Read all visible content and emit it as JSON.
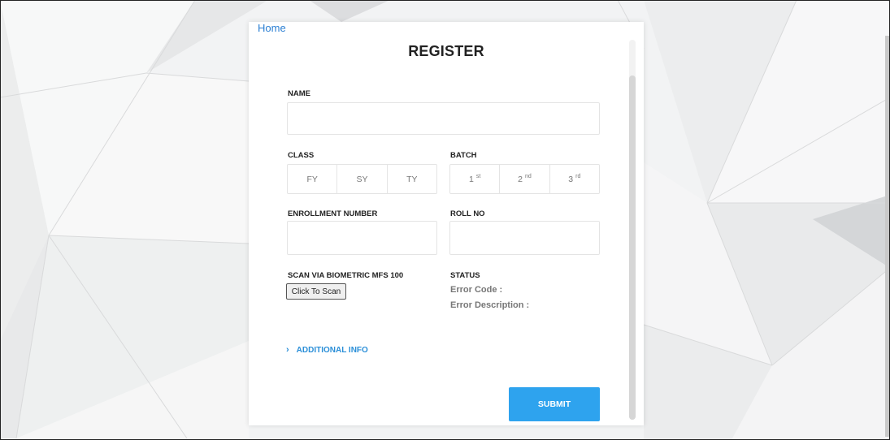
{
  "nav": {
    "home_label": "Home"
  },
  "form": {
    "title": "REGISTER",
    "name": {
      "label": "NAME",
      "value": ""
    },
    "class": {
      "label": "CLASS",
      "options": [
        "FY",
        "SY",
        "TY"
      ]
    },
    "batch": {
      "label": "BATCH",
      "options": [
        {
          "num": "1",
          "suffix": "st"
        },
        {
          "num": "2",
          "suffix": "nd"
        },
        {
          "num": "3",
          "suffix": "rd"
        }
      ]
    },
    "enrollment": {
      "label": "ENROLLMENT NUMBER",
      "value": ""
    },
    "roll": {
      "label": "ROLL NO",
      "value": ""
    },
    "scan": {
      "label": "SCAN VIA BIOMETRIC MFS 100",
      "button_label": "Click To Scan"
    },
    "status": {
      "label": "STATUS",
      "error_code_label": "Error Code :",
      "error_desc_label": "Error Description :"
    },
    "additional_info_label": "ADDITIONAL INFO",
    "submit_label": "SUBMIT"
  },
  "colors": {
    "accent": "#2ea3ee",
    "link": "#2b7fd3"
  },
  "icons": {
    "additional_info": "chevron-right-icon"
  }
}
